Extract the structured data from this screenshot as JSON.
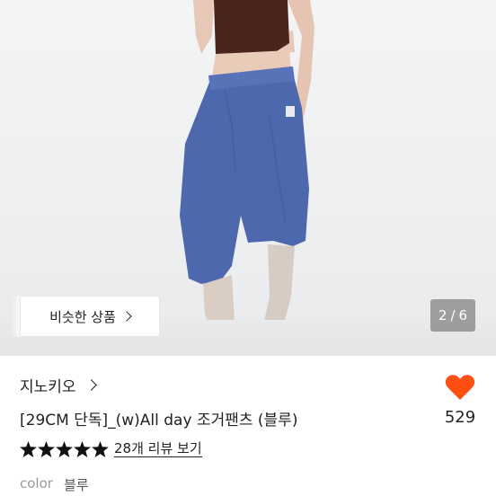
{
  "image": {
    "alt_icon": "product-photo"
  },
  "similar_button": {
    "label": "비슷한 상품"
  },
  "pager": {
    "current": "2",
    "separator": "/",
    "total": "6"
  },
  "brand": {
    "name": "지노키오"
  },
  "product": {
    "title": "[29CM 단독]_(w)All day 조거팬츠 (블루)",
    "likes": "529",
    "rating_stars": 5,
    "reviews_label": "28개 리뷰 보기",
    "option_label": "color",
    "option_value": "블루"
  },
  "colors": {
    "heart": "#ff4f12",
    "star": "#111111"
  }
}
